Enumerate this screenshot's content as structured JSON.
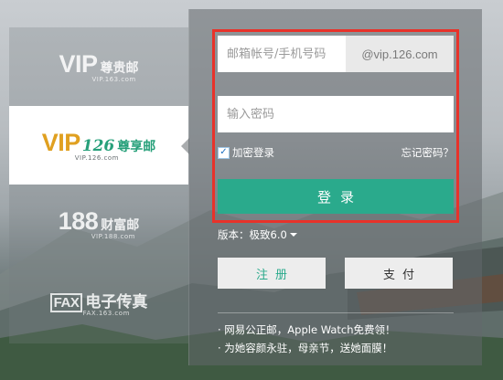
{
  "brands": [
    {
      "big": "VIP",
      "cn": "尊贵邮",
      "url": "VIP.163.com",
      "active": false
    },
    {
      "big": "VIP",
      "num": "126",
      "cn": "尊享邮",
      "url": "VIP.126.com",
      "active": true
    },
    {
      "big": "188",
      "cn": "财富邮",
      "url": "VIP.188.com",
      "active": false
    },
    {
      "big": "FAX",
      "cn": "电子传真",
      "url": "FAX.163.com",
      "active": false
    }
  ],
  "login": {
    "account_placeholder": "邮箱帐号/手机号码",
    "account_suffix": "@vip.126.com",
    "password_placeholder": "输入密码",
    "encrypt_label": "加密登录",
    "encrypt_checked": "✓",
    "forgot_label": "忘记密码？",
    "login_label": "登录"
  },
  "version": {
    "label": "版本：极致6.0"
  },
  "buttons": {
    "register": "注册",
    "pay": "支付"
  },
  "news": [
    "· 网易公正邮，Apple Watch免费领！",
    "· 为她容颜永驻，母亲节，送她面膜！"
  ],
  "colors": {
    "accent": "#2aaa8c",
    "highlight": "#e8322a",
    "gold": "#e0a020"
  }
}
